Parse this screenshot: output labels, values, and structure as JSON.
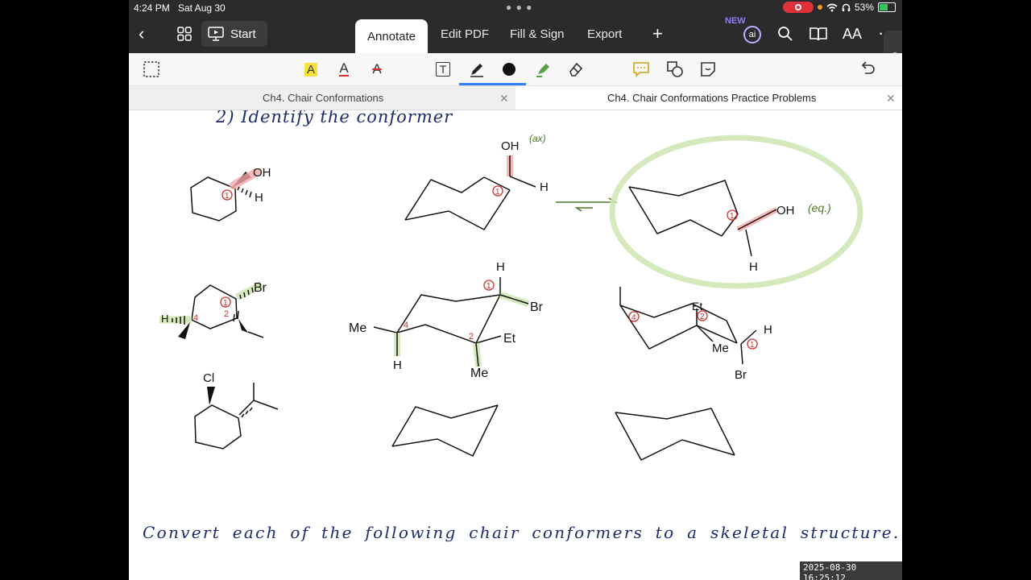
{
  "status_bar": {
    "time": "4:24 PM",
    "date": "Sat Aug 30",
    "battery_pct": "53%",
    "battery_level": 0.53
  },
  "toolbar": {
    "start_label": "Start",
    "tabs": [
      "Annotate",
      "Edit PDF",
      "Fill & Sign",
      "Export"
    ],
    "active_tab": "Annotate",
    "ai_badge": "NEW",
    "ai_label": "ai",
    "text_size_label": "AA"
  },
  "annotate_tools": {
    "highlight_label": "A",
    "underline_label": "A",
    "strike_label": "A",
    "text_tool_label": "T",
    "colors": {
      "highlight": "#f5e33b",
      "underline_red": "#d62c2c",
      "active_accent": "#2d7ef7"
    }
  },
  "document_tabs": [
    {
      "title": "Ch4. Chair Conformations",
      "active": false
    },
    {
      "title": "Ch4. Chair Conformations Practice Problems",
      "active": true
    }
  ],
  "page": {
    "heading": "2) Identify the conformer",
    "bottom_instruction": "Convert each of the following chair conformers to a skeletal structure.",
    "ink_colors": {
      "navy": "#1c2b6b",
      "green": "#4a7a24",
      "red": "#c9302c",
      "highlight_red": "#f4a6a6",
      "highlight_green": "#cfe8b6"
    },
    "row1": {
      "skeletal": {
        "substituent": "OH",
        "h": "H",
        "carbon_label": "1"
      },
      "axial_chair": {
        "top": "OH",
        "note": "(ax)",
        "right": "H",
        "carbon_label": "1"
      },
      "equatorial_chair": {
        "right": "OH",
        "note": "(eq.)",
        "bottom": "H",
        "carbon_label": "1"
      }
    },
    "row2": {
      "skeletal": {
        "br": "Br",
        "h": "H",
        "c1": "1",
        "c2": "2",
        "c4": "4"
      },
      "chair_a": {
        "h_top": "H",
        "br": "Br",
        "me_left": "Me",
        "h_bottom": "H",
        "et": "Et",
        "me_bottom": "Me",
        "c1": "1",
        "c2": "2",
        "c4": "4"
      },
      "chair_b": {
        "et": "Et",
        "me": "Me",
        "h": "H",
        "br": "Br",
        "c1": "1",
        "c2": "2",
        "c4": "4"
      }
    },
    "row3": {
      "skeletal": {
        "cl": "Cl"
      }
    }
  },
  "timestamp": "2025-08-30 16:25:12"
}
